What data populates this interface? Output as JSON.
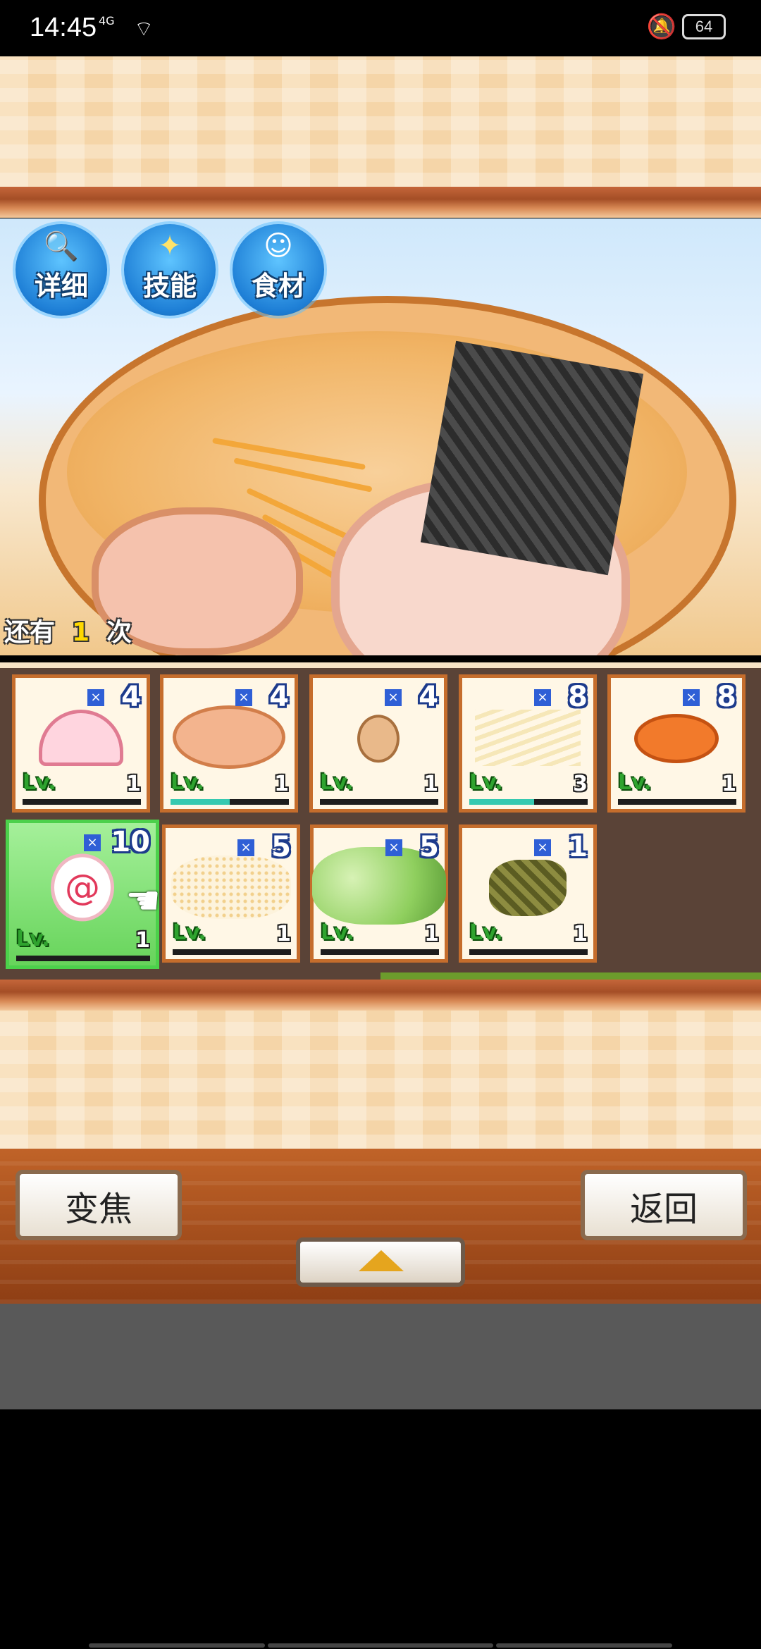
{
  "status_bar": {
    "time": "14:45",
    "network": "4G",
    "battery": "64"
  },
  "top_buttons": [
    {
      "label": "详细",
      "icon": "magnifier-icon"
    },
    {
      "label": "技能",
      "icon": "sparkle-icon"
    },
    {
      "label": "食材",
      "icon": "chef-icon"
    }
  ],
  "remaining": {
    "prefix": "还有",
    "count": "1",
    "suffix": "次"
  },
  "ingredients": [
    {
      "name": "kamaboko",
      "count": "4",
      "level": "1",
      "progress": 0
    },
    {
      "name": "chicken",
      "count": "4",
      "level": "1",
      "progress": 0.5
    },
    {
      "name": "egg",
      "count": "4",
      "level": "1",
      "progress": 0
    },
    {
      "name": "bean-sprouts",
      "count": "8",
      "level": "3",
      "progress": 0.55
    },
    {
      "name": "carrot",
      "count": "8",
      "level": "1",
      "progress": 0
    },
    {
      "name": "naruto",
      "count": "10",
      "level": "1",
      "progress": 0,
      "selected": true
    },
    {
      "name": "sesame",
      "count": "5",
      "level": "1",
      "progress": 0
    },
    {
      "name": "cabbage",
      "count": "5",
      "level": "1",
      "progress": 0
    },
    {
      "name": "seaweed",
      "count": "1",
      "level": "1",
      "progress": 0
    }
  ],
  "level_prefix": "Lv.",
  "count_prefix": "×",
  "buttons": {
    "zoom": "变焦",
    "back": "返回"
  },
  "colors": {
    "accent": "#1e7fd6",
    "selected": "#67d45b",
    "tile_border": "#c56d2c"
  }
}
